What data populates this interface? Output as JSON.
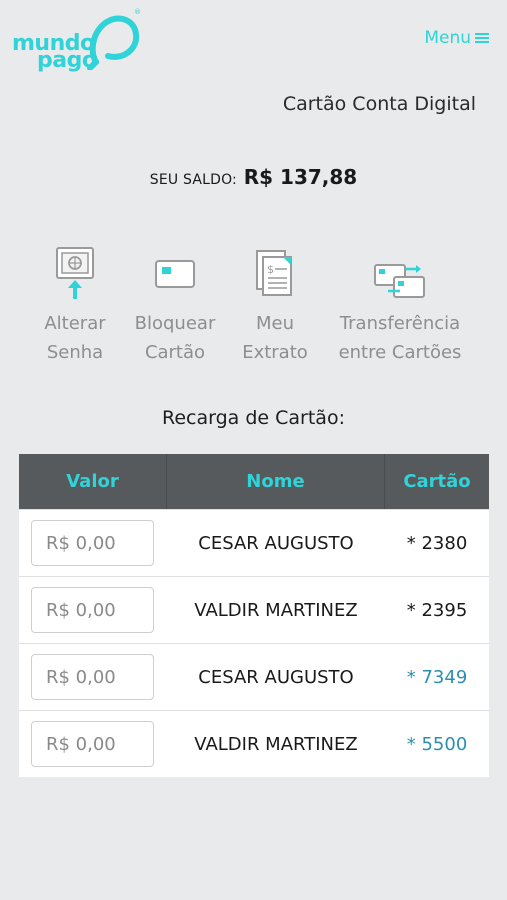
{
  "brand": {
    "line1": "mundo",
    "line2": "pago",
    "color": "#2fd3d8"
  },
  "header": {
    "menu_label": "Menu"
  },
  "page": {
    "title": "Cartão Conta Digital"
  },
  "balance": {
    "label": "SEU SALDO:",
    "value": "R$ 137,88"
  },
  "actions": [
    {
      "line1": "Alterar",
      "line2": "Senha",
      "icon": "safe-icon"
    },
    {
      "line1": "Bloquear",
      "line2": "Cartão",
      "icon": "card-icon"
    },
    {
      "line1": "Meu",
      "line2": "Extrato",
      "icon": "statement-icon"
    },
    {
      "line1": "Transferência",
      "line2": "entre Cartões",
      "icon": "transfer-icon"
    }
  ],
  "recharge": {
    "title": "Recarga de Cartão:",
    "columns": [
      "Valor",
      "Nome",
      "Cartão"
    ],
    "input_placeholder": "R$ 0,00",
    "rows": [
      {
        "name": "CESAR AUGUSTO",
        "card": "* 2380"
      },
      {
        "name": "VALDIR MARTINEZ",
        "card": "* 2395"
      },
      {
        "name": "CESAR AUGUSTO",
        "card": "* 7349"
      },
      {
        "name": "VALDIR MARTINEZ",
        "card": "* 5500"
      }
    ]
  },
  "colors": {
    "accent": "#2fd3d8",
    "header_bg": "#565a5c",
    "link": "#2b8fb0",
    "page_bg": "#e8eaeb"
  }
}
